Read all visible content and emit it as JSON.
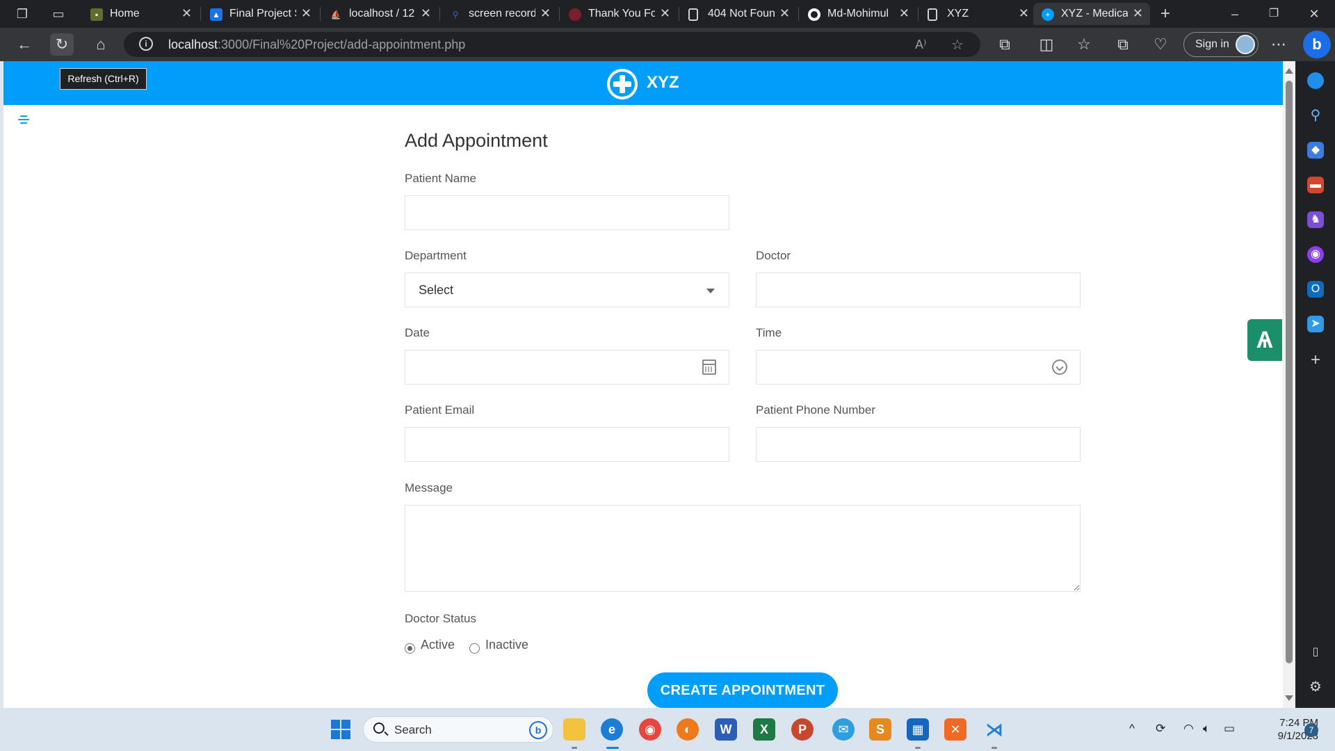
{
  "browser": {
    "tabs": [
      {
        "label": "Home",
        "icon": "picture-icon",
        "color": "#5f6d2f"
      },
      {
        "label": "Final Project S",
        "icon": "contacts-icon",
        "color": "#1a73e8"
      },
      {
        "label": "localhost / 12",
        "icon": "phpmyadmin-icon",
        "color": "#e08a1e"
      },
      {
        "label": "screen record",
        "icon": "search-icon",
        "color": "#2b6fd6"
      },
      {
        "label": "Thank You Fo",
        "icon": "site-icon",
        "color": "#7a1f2b"
      },
      {
        "label": "404 Not Foun",
        "icon": "page-icon",
        "color": "#cfd3d8"
      },
      {
        "label": "Md-Mohimul",
        "icon": "github-icon",
        "color": "#ffffff"
      },
      {
        "label": "XYZ",
        "icon": "page-icon",
        "color": "#cfd3d8"
      },
      {
        "label": "XYZ - Medica",
        "icon": "medical-logo-icon",
        "color": "#009efb"
      }
    ],
    "url_host": "localhost",
    "url_path": ":3000/Final%20Project/add-appointment.php",
    "sign_in_label": "Sign in",
    "tooltip": "Refresh (Ctrl+R)"
  },
  "page": {
    "brand": "XYZ",
    "title": "Add Appointment",
    "fields": {
      "patient_name": {
        "label": "Patient Name",
        "value": ""
      },
      "department": {
        "label": "Department",
        "value": "Select"
      },
      "doctor": {
        "label": "Doctor",
        "value": ""
      },
      "date": {
        "label": "Date",
        "value": ""
      },
      "time": {
        "label": "Time",
        "value": ""
      },
      "email": {
        "label": "Patient Email",
        "value": ""
      },
      "phone": {
        "label": "Patient Phone Number",
        "value": ""
      },
      "message": {
        "label": "Message",
        "value": ""
      }
    },
    "doctor_status": {
      "label": "Doctor Status",
      "options": [
        "Active",
        "Inactive"
      ],
      "selected": "Active"
    },
    "submit_label": "CREATE APPOINTMENT"
  },
  "taskbar": {
    "search_label": "Search",
    "time": "7:24 PM",
    "date": "9/1/2023",
    "notification_count": "7"
  },
  "colors": {
    "accent": "#009efb",
    "tool_green": "#1b8f6a"
  }
}
